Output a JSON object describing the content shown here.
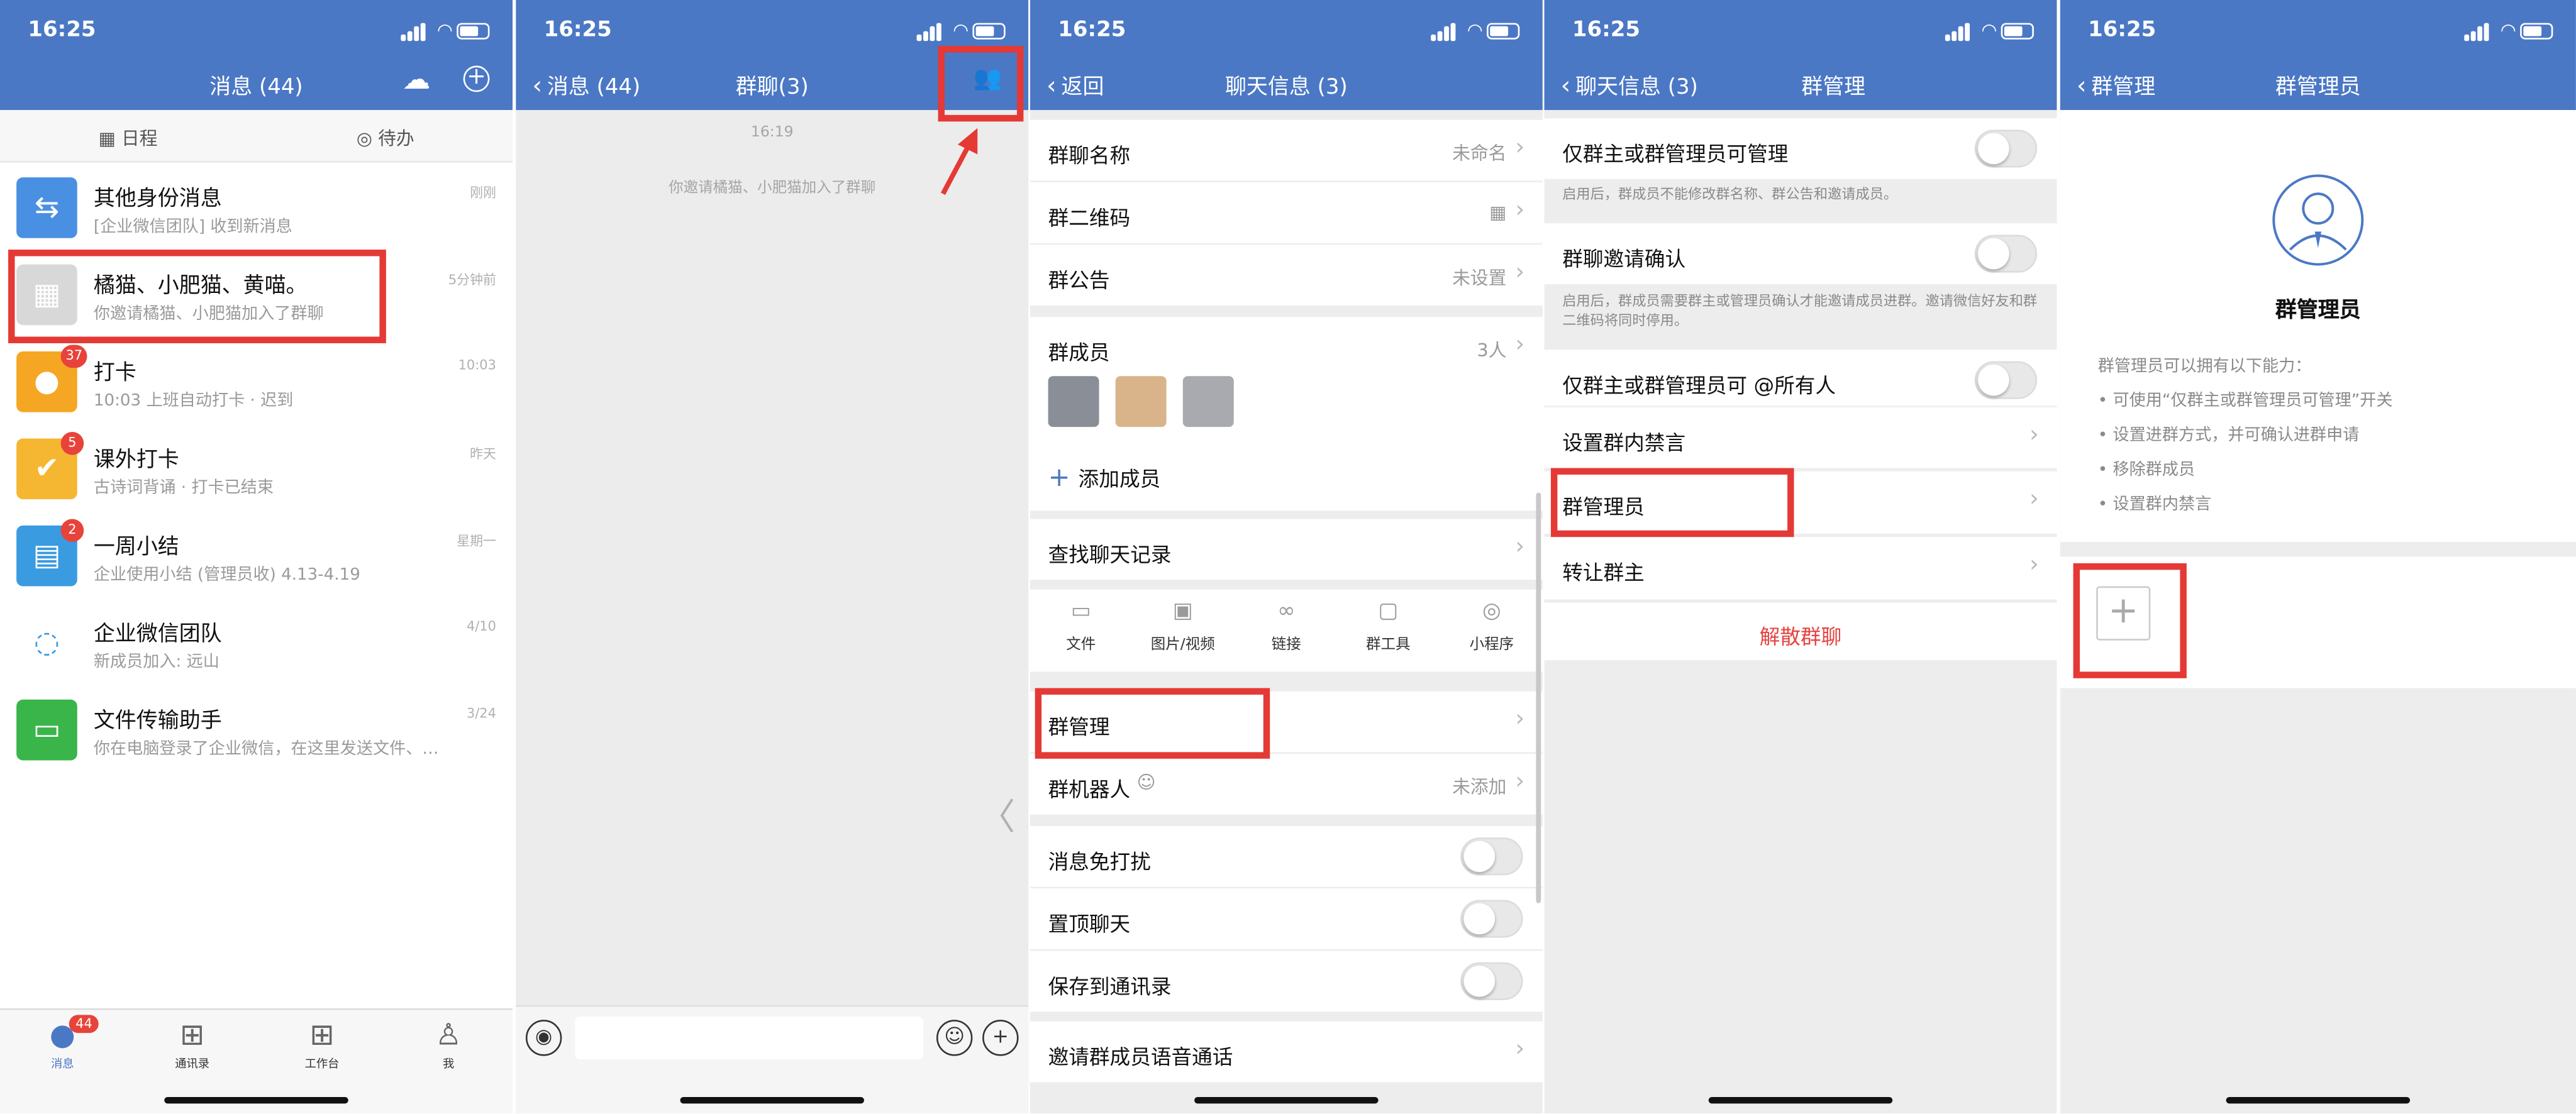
{
  "status": {
    "time": "16:25",
    "loc": "➤"
  },
  "p1": {
    "title": "消息 (44)",
    "tabs": {
      "schedule": "日程",
      "todo": "待办"
    },
    "chats": [
      {
        "name": "其他身份消息",
        "subtitle": "[企业微信团队] 收到新消息",
        "time": "刚刚",
        "badge": "",
        "color": "#4a90e2",
        "icon": "⇆"
      },
      {
        "name": "橘猫、小肥猫、黄喵。",
        "subtitle": "你邀请橘猫、小肥猫加入了群聊",
        "time": "5分钟前",
        "badge": "",
        "color": "#d8d8d8",
        "icon": "▦"
      },
      {
        "name": "打卡",
        "subtitle": "10:03 上班自动打卡 · 迟到",
        "time": "10:03",
        "badge": "37",
        "color": "#f5a623",
        "icon": "●"
      },
      {
        "name": "课外打卡",
        "subtitle": "古诗词背诵 · 打卡已结束",
        "time": "昨天",
        "badge": "5",
        "color": "#f5b731",
        "icon": "✔"
      },
      {
        "name": "一周小结",
        "subtitle": "企业使用小结 (管理员收) 4.13-4.19",
        "time": "星期一",
        "badge": "2",
        "color": "#3a9be0",
        "icon": "▤"
      },
      {
        "name": "企业微信团队",
        "subtitle": "新成员加入: 远山",
        "time": "4/10",
        "badge": "",
        "color": "#ffffff",
        "icon": "◌"
      },
      {
        "name": "文件传输助手",
        "subtitle": "你在电脑登录了企业微信，在这里发送文件、…",
        "time": "3/24",
        "badge": "",
        "color": "#39b54a",
        "icon": "▭"
      }
    ],
    "tabbar": {
      "badge": "44",
      "messages": "消息",
      "contacts": "通讯录",
      "workbench": "工作台",
      "me": "我"
    }
  },
  "p2": {
    "back": "消息 (44)",
    "title": "群聊(3)",
    "time": "16:19",
    "system": "你邀请橘猫、小肥猫加入了群聊"
  },
  "p3": {
    "back": "返回",
    "title": "聊天信息 (3)",
    "group_name_label": "群聊名称",
    "group_name_value": "未命名",
    "qr_label": "群二维码",
    "notice_label": "群公告",
    "notice_value": "未设置",
    "members_label": "群成员",
    "members_value": "3人",
    "add_member": "添加成员",
    "search_history": "查找聊天记录",
    "tools": [
      "文件",
      "图片/视频",
      "链接",
      "群工具",
      "小程序"
    ],
    "group_manage": "群管理",
    "bot_label": "群机器人",
    "bot_value": "未添加",
    "mute": "消息免打扰",
    "pin": "置顶聊天",
    "save_contacts": "保存到通讯录",
    "voice_call": "邀请群成员语音通话"
  },
  "p4": {
    "back": "聊天信息 (3)",
    "title": "群管理",
    "admin_only": "仅群主或群管理员可管理",
    "admin_only_desc": "启用后，群成员不能修改群名称、群公告和邀请成员。",
    "invite_confirm": "群聊邀请确认",
    "invite_confirm_desc": "启用后，群成员需要群主或管理员确认才能邀请成员进群。邀请微信好友和群二维码将同时停用。",
    "at_all": "仅群主或群管理员可 @所有人",
    "ban": "设置群内禁言",
    "admins": "群管理员",
    "transfer": "转让群主",
    "dismiss": "解散群聊"
  },
  "p5": {
    "back": "群管理",
    "title": "群管理员",
    "heading": "群管理员",
    "intro": "群管理员可以拥有以下能力：",
    "abilities": [
      "• 可使用“仅群主或群管理员可管理”开关",
      "• 设置进群方式，并可确认进群申请",
      "• 移除群成员",
      "• 设置群内禁言"
    ],
    "add": "+"
  },
  "colors": {
    "header": "#4b78c5",
    "highlight": "#e53935",
    "danger": "#e64340"
  }
}
